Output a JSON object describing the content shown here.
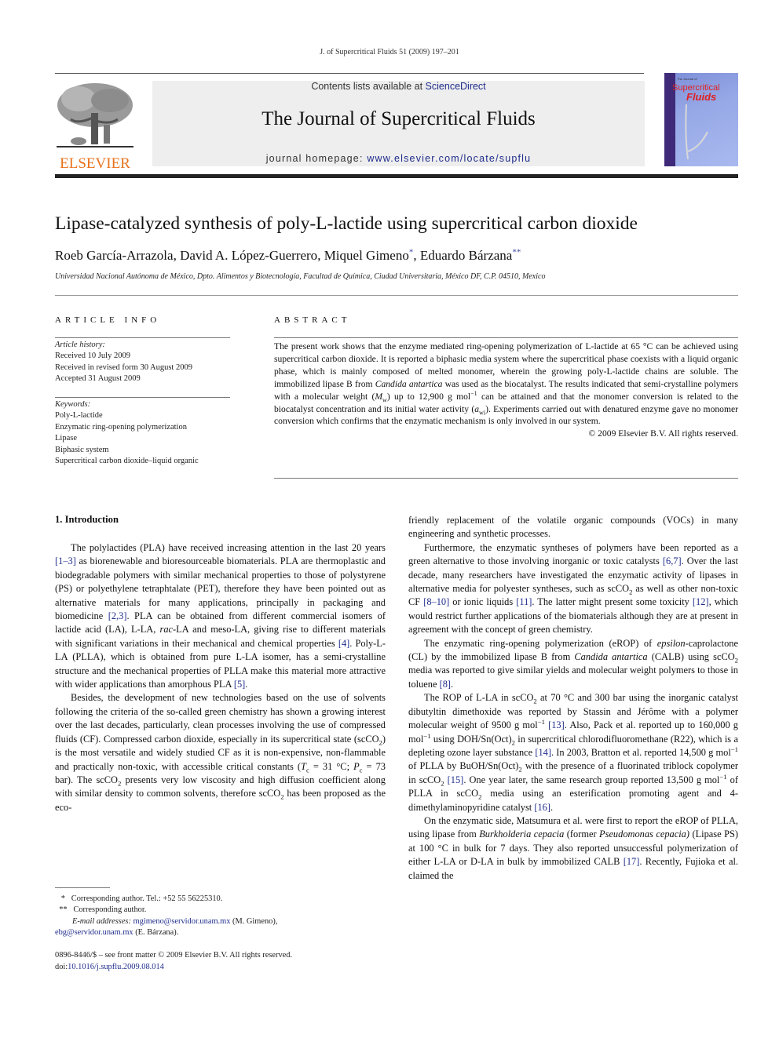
{
  "header": {
    "running_head": "J. of Supercritical Fluids 51 (2009) 197–201",
    "contents_prefix": "Contents lists available at ",
    "contents_link": "ScienceDirect",
    "journal_title": "The Journal of Supercritical Fluids",
    "homepage_prefix": "journal homepage: ",
    "homepage_link": "www.elsevier.com/locate/supflu",
    "publisher_logo_text": "ELSEVIER",
    "cover_small_text": "The Journal of",
    "cover_title_1": "Supercritical",
    "cover_title_2": "Fluids",
    "colors": {
      "link": "#1f2c8c",
      "elsevier_orange": "#e9711c",
      "cover_red": "#e02020",
      "cover_blue": "#96a8e6",
      "cover_spine": "#3e2a78"
    }
  },
  "article": {
    "title": "Lipase-catalyzed synthesis of poly-L-lactide using supercritical carbon dioxide",
    "authors": [
      {
        "name": "Roeb García-Arrazola",
        "mark": ""
      },
      {
        "name": "David A. López-Guerrero",
        "mark": ""
      },
      {
        "name": "Miquel Gimeno",
        "mark": "*"
      },
      {
        "name": "Eduardo Bárzana",
        "mark": "**"
      }
    ],
    "affiliation": "Universidad Nacional Autónoma de México, Dpto. Alimentos y Biotecnología, Facultad de Química, Ciudad Universitaria, México DF, C.P. 04510, Mexico"
  },
  "article_info": {
    "heading": "ARTICLE INFO",
    "history_label": "Article history:",
    "history": [
      "Received 10 July 2009",
      "Received in revised form 30 August 2009",
      "Accepted 31 August 2009"
    ],
    "keywords_label": "Keywords:",
    "keywords": [
      "Poly-L-lactide",
      "Enzymatic ring-opening polymerization",
      "Lipase",
      "Biphasic system",
      "Supercritical carbon dioxide–liquid organic"
    ]
  },
  "abstract": {
    "heading": "ABSTRACT",
    "text_1": "The present work shows that the enzyme mediated ring-opening polymerization of L-lactide at 65 °C can be achieved using supercritical carbon dioxide. It is reported a biphasic media system where the supercritical phase coexists with a liquid organic phase, which is mainly composed of melted monomer, wherein the growing poly-L-lactide chains are soluble. The immobilized lipase B from ",
    "species": "Candida antartica",
    "text_2": " was used as the biocatalyst. The results indicated that semi-crystalline polymers with a molecular weight (",
    "mw_symbol": "M",
    "mw_sub": "w",
    "text_3": ") up to 12,900 g mol",
    "exp": "−1",
    "text_4": " can be attained and that the monomer conversion is related to the biocatalyst concentration and its initial water activity (",
    "aw_symbol": "a",
    "aw_sub": "wi",
    "text_5": "). Experiments carried out with denatured enzyme gave no monomer conversion which confirms that the enzymatic mechanism is only involved in our system.",
    "copyright": "© 2009 Elsevier B.V. All rights reserved."
  },
  "intro": {
    "heading": "1.  Introduction",
    "left_html": [
      "The polylactides (PLA) have received increasing attention in the last 20 years <span class=\"link\">[1–3]</span> as biorenewable and bioresourceable biomaterials. PLA are thermoplastic and biodegradable polymers with similar mechanical properties to those of polystyrene (PS) or polyethylene tetraphtalate (PET), therefore they have been pointed out as alternative materials for many applications, principally in packaging and biomedicine <span class=\"link\">[2,3]</span>. PLA can be obtained from different commercial isomers of lactide acid (LA), L-LA, <i>rac</i>-LA and meso-LA, giving rise to different materials with significant variations in their mechanical and chemical properties <span class=\"link\">[4]</span>. Poly-L-LA (PLLA), which is obtained from pure L-LA isomer, has a semi-crystalline structure and the mechanical properties of PLLA make this material more attractive with wider applications than amorphous PLA <span class=\"link\">[5]</span>.",
      "Besides, the development of new technologies based on the use of solvents following the criteria of the so-called green chemistry has shown a growing interest over the last decades, particularly, clean processes involving the use of compressed fluids (CF). Compressed carbon dioxide, especially in its supercritical state (scCO<sub>2</sub>) is the most versatile and widely studied CF as it is non-expensive, non-flammable and practically non-toxic, with accessible critical constants (<i>T</i><sub>c</sub> = 31 °C; <i>P</i><sub>c</sub> = 73 bar). The scCO<sub>2</sub> presents very low viscosity and high diffusion coefficient along with similar density to common solvents, therefore scCO<sub>2</sub> has been proposed as the eco-"
    ],
    "right_html": [
      "friendly replacement of the volatile organic compounds (VOCs) in many engineering and synthetic processes.",
      "Furthermore, the enzymatic syntheses of polymers have been reported as a green alternative to those involving inorganic or toxic catalysts <span class=\"link\">[6,7]</span>. Over the last decade, many researchers have investigated the enzymatic activity of lipases in alternative media for polyester syntheses, such as scCO<sub>2</sub> as well as other non-toxic CF <span class=\"link\">[8–10]</span> or ionic liquids <span class=\"link\">[11]</span>. The latter might present some toxicity <span class=\"link\">[12]</span>, which would restrict further applications of the biomaterials although they are at present in agreement with the concept of green chemistry.",
      "The enzymatic ring-opening polymerization (eROP) of <i>epsilon</i>-caprolactone (CL) by the immobilized lipase B from <i>Candida antartica</i> (CALB) using scCO<sub>2</sub> media was reported to give similar yields and molecular weight polymers to those in toluene <span class=\"link\">[8]</span>.",
      "The ROP of L-LA in scCO<sub>2</sub> at 70 °C and 300 bar using the inorganic catalyst dibutyltin dimethoxide was reported by Stassin and Jérôme with a polymer molecular weight of 9500 g mol<sup>−1</sup> <span class=\"link\">[13]</span>. Also, Pack et al. reported up to 160,000 g mol<sup>−1</sup> using DOH/Sn(Oct)<sub>2</sub> in supercritical chlorodifluoromethane (R22), which is a depleting ozone layer substance <span class=\"link\">[14]</span>. In 2003, Bratton et al. reported 14,500 g mol<sup>−1</sup> of PLLA by BuOH/Sn(Oct)<sub>2</sub> with the presence of a fluorinated triblock copolymer in scCO<sub>2</sub> <span class=\"link\">[15]</span>. One year later, the same research group reported 13,500 g mol<sup>−1</sup> of PLLA in scCO<sub>2</sub> media using an esterification promoting agent and 4-dimethylaminopyridine catalyst <span class=\"link\">[16]</span>.",
      "On the enzymatic side, Matsumura et al. were first to report the eROP of PLLA, using lipase from <i>Burkholderia cepacia</i> (former <i>Pseudomonas cepacia)</i> (Lipase PS) at 100 °C in bulk for 7 days. They also reported unsuccessful polymerization of either L-LA or D-LA in bulk by immobilized CALB <span class=\"link\">[17]</span>. Recently, Fujioka et al. claimed the"
    ]
  },
  "footnotes": {
    "fn1_mark": "*",
    "fn1_text": "Corresponding author. Tel.: +52 55 56225310.",
    "fn2_mark": "**",
    "fn2_text": "Corresponding author.",
    "email_label": "E-mail addresses:",
    "email_1": "mgimeno@servidor.unam.mx",
    "email_1_name": " (M. Gimeno),",
    "email_2": "ebg@servidor.unam.mx",
    "email_2_name": " (E. Bárzana).",
    "issn_line": "0896-8446/$ – see front matter © 2009 Elsevier B.V. All rights reserved.",
    "doi_prefix": "doi:",
    "doi": "10.1016/j.supflu.2009.08.014"
  }
}
